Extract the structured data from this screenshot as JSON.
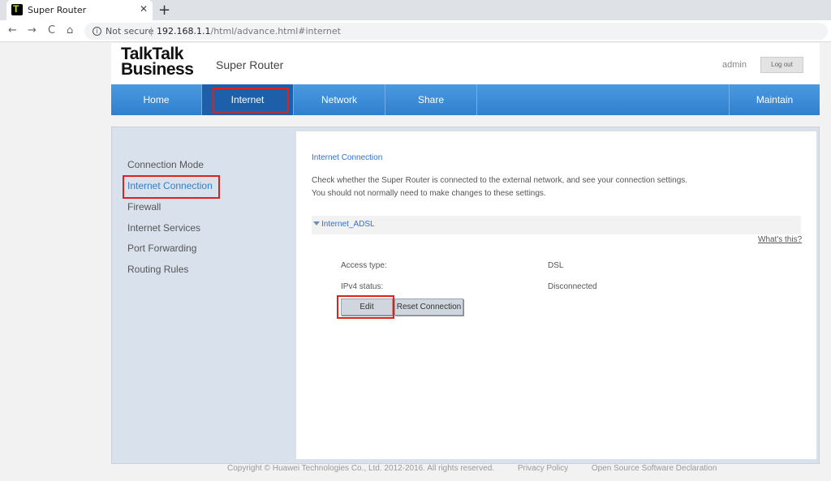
{
  "browser": {
    "tab_title": "Super Router",
    "tab_close": "✕",
    "new_tab": "+",
    "back": "←",
    "forward": "→",
    "reload": "C",
    "home": "⌂",
    "info": "i",
    "not_secure": "Not secure",
    "separator": "|",
    "url_host": "192.168.1.1",
    "url_path": "/html/advance.html#internet"
  },
  "header": {
    "brand_line1": "TalkTalk",
    "brand_line2": "Business",
    "product": "Super Router",
    "user": "admin",
    "logout_label": "Log out"
  },
  "mainnav": [
    {
      "label": "Home"
    },
    {
      "label": "Internet"
    },
    {
      "label": "Network"
    },
    {
      "label": "Share"
    },
    {
      "label": "Maintain"
    }
  ],
  "sidebar": {
    "items": [
      {
        "label": "Connection Mode"
      },
      {
        "label": "Internet Connection"
      },
      {
        "label": "Firewall"
      },
      {
        "label": "Internet Services"
      },
      {
        "label": "Port Forwarding"
      },
      {
        "label": "Routing Rules"
      }
    ]
  },
  "main": {
    "title": "Internet Connection",
    "desc_line1": "Check whether the Super Router is connected to the external network, and see your connection settings.",
    "desc_line2": "You should not normally need to make changes to these settings.",
    "connection_name": "Internet_ADSL",
    "whats_this": "What's this?",
    "fields": [
      {
        "label": "Access type:",
        "value": "DSL"
      },
      {
        "label": "IPv4 status:",
        "value": "Disconnected"
      }
    ],
    "edit_label": "Edit",
    "reset_label": "Reset Connection"
  },
  "footer": {
    "copyright": "Copyright © Huawei Technologies Co., Ltd. 2012-2016. All rights reserved.",
    "privacy": "Privacy Policy",
    "oss": "Open Source Software Declaration"
  },
  "colors": {
    "nav_blue": "#2f7fcf",
    "nav_active": "#1d5fa8",
    "highlight_red": "#e0201d",
    "link_blue": "#2f6fcf"
  }
}
